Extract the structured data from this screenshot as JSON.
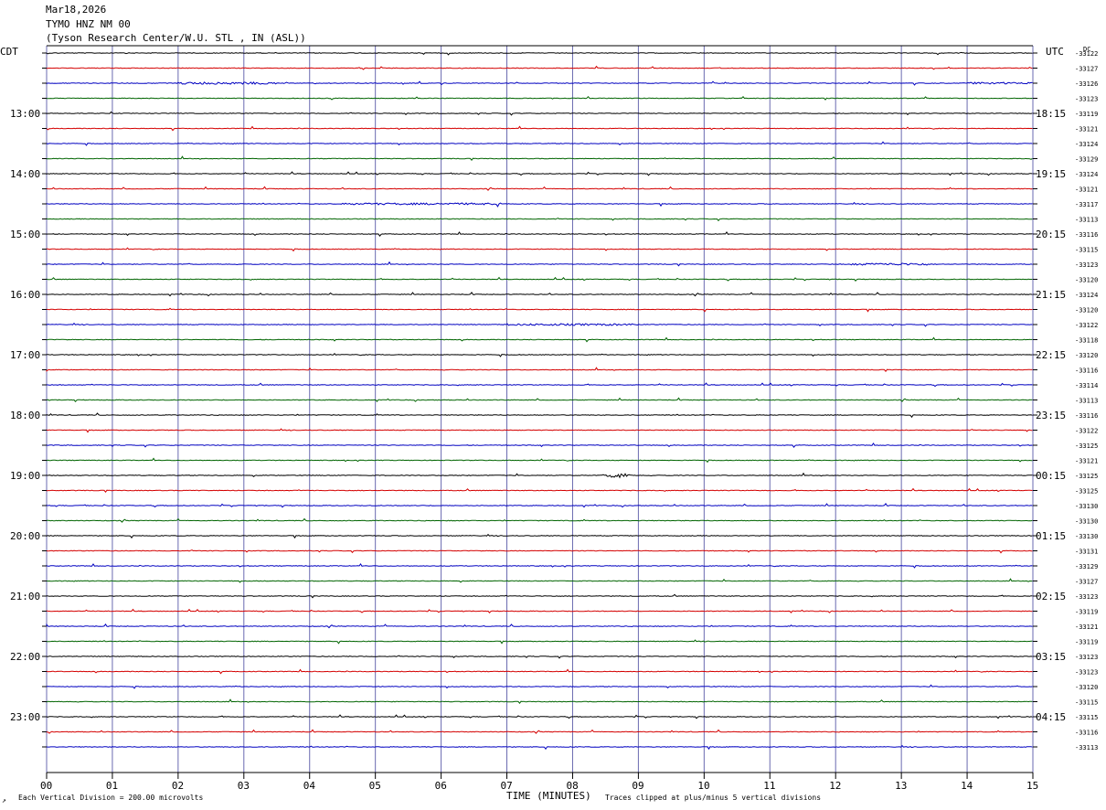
{
  "header": {
    "date": "Mar18,2026",
    "station": "TYMO HNZ NM 00",
    "location": "(Tyson Research Center/W.U. STL , IN (ASL))"
  },
  "labels": {
    "left_tz": "CDT",
    "right_tz": "UTC",
    "dc": "DC",
    "xlabel": "TIME (MINUTES)",
    "scale_note": "Each Vertical Division =  200.00 microvolts",
    "clip_note": "Traces clipped at plus/minus 5 vertical divisions",
    "corner_mark": "↗"
  },
  "colors": {
    "trace_cycle": [
      "#000000",
      "#d40000",
      "#0000c0",
      "#006400"
    ],
    "grid_vertical": "#6a6ab0",
    "grid_horizontal": "#000000"
  },
  "chart_data": {
    "type": "helicorder",
    "title": "",
    "xlabel": "TIME (MINUTES)",
    "ylabel": "",
    "x_ticks": [
      "00",
      "01",
      "02",
      "03",
      "04",
      "05",
      "06",
      "07",
      "08",
      "09",
      "10",
      "11",
      "12",
      "13",
      "14",
      "15"
    ],
    "xlim": [
      0,
      15
    ],
    "rows_per_hour": 4,
    "minutes_per_row": 15,
    "left_hour_labels": [
      "13:00",
      "14:00",
      "15:00",
      "16:00",
      "17:00",
      "18:00",
      "19:00",
      "20:00",
      "21:00",
      "22:00",
      "23:00"
    ],
    "right_hour_labels": [
      "18:15",
      "19:15",
      "20:15",
      "21:15",
      "22:15",
      "23:15",
      "00:15",
      "01:15",
      "02:15",
      "03:15",
      "04:15"
    ],
    "dc_offsets": [
      -33122,
      -33127,
      -33126,
      -33123,
      -33119,
      -33121,
      -33124,
      -33129,
      -33124,
      -33121,
      -33117,
      -33113,
      -33116,
      -33115,
      -33123,
      -33120,
      -33124,
      -33120,
      -33122,
      -33118,
      -33120,
      -33116,
      -33114,
      -33113,
      -33116,
      -33122,
      -33125,
      -33121,
      -33125,
      -33125,
      -33130,
      -33130,
      -33130,
      -33131,
      -33129,
      -33127,
      -33123,
      -33119,
      -33121,
      -33119,
      -33123,
      -33123,
      -33120,
      -33115,
      -33115,
      -33116,
      -33113
    ],
    "events": [
      {
        "row": 2,
        "x_start": 2.0,
        "x_end": 3.5,
        "amplitude": 1.2
      },
      {
        "row": 2,
        "x_start": 14.0,
        "x_end": 15.0,
        "amplitude": 1.0
      },
      {
        "row": 10,
        "x_start": 4.5,
        "x_end": 7.0,
        "amplitude": 1.0
      },
      {
        "row": 14,
        "x_start": 12.2,
        "x_end": 13.4,
        "amplitude": 1.2
      },
      {
        "row": 18,
        "x_start": 7.0,
        "x_end": 9.0,
        "amplitude": 1.0
      },
      {
        "row": 28,
        "x_start": 8.5,
        "x_end": 8.9,
        "amplitude": 2.5
      }
    ]
  }
}
